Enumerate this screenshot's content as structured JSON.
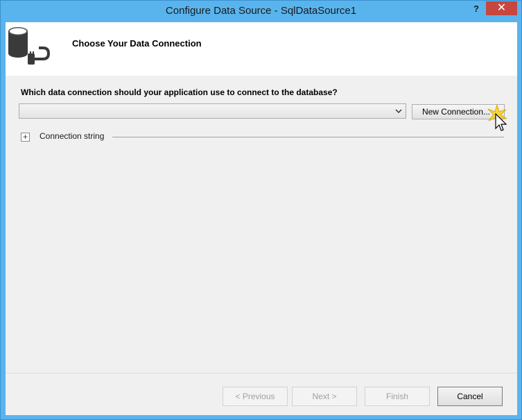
{
  "window": {
    "title": "Configure Data Source - SqlDataSource1",
    "help_label": "?",
    "close_label": "✕"
  },
  "header": {
    "icon": "database-plug-icon",
    "title": "Choose Your Data Connection"
  },
  "connection": {
    "question": "Which data connection should your application use to connect to the database?",
    "selected_value": "",
    "new_connection_label": "New Connection...",
    "connection_string_label": "Connection string",
    "expander_label": "+"
  },
  "footer": {
    "previous_label": "< Previous",
    "next_label": "Next >",
    "finish_label": "Finish",
    "cancel_label": "Cancel"
  },
  "colors": {
    "title_bar": "#59b4ee",
    "close_button": "#c7463f",
    "client_bg": "#f0f0f0"
  }
}
